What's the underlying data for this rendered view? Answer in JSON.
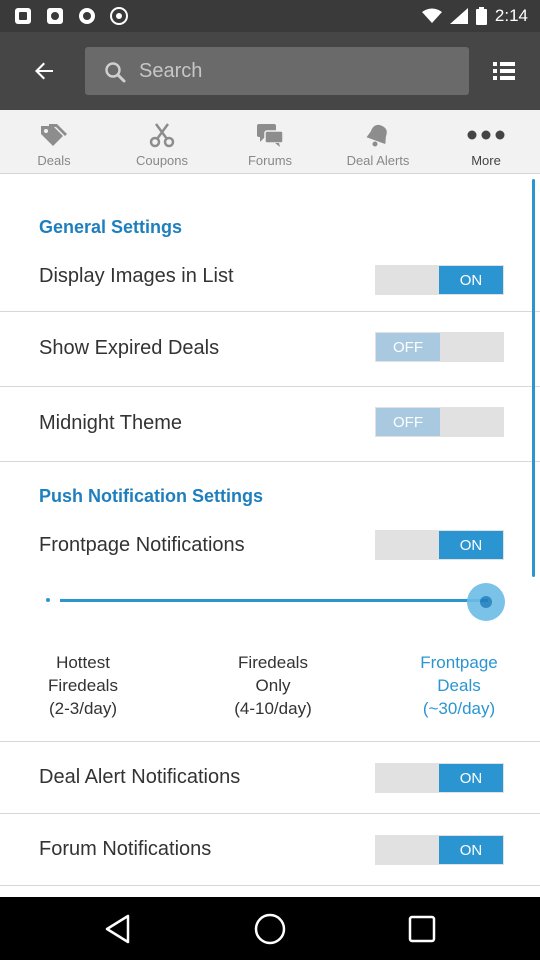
{
  "status_bar": {
    "time": "2:14"
  },
  "app_bar": {
    "search_placeholder": "Search"
  },
  "tabs": [
    {
      "label": "Deals",
      "icon": "tag-icon"
    },
    {
      "label": "Coupons",
      "icon": "scissors-icon"
    },
    {
      "label": "Forums",
      "icon": "chat-icon"
    },
    {
      "label": "Deal Alerts",
      "icon": "bell-icon"
    },
    {
      "label": "More",
      "icon": "more-icon"
    }
  ],
  "general": {
    "header": "General Settings",
    "display_images": {
      "label": "Display Images in List",
      "value": "ON"
    },
    "show_expired": {
      "label": "Show Expired Deals",
      "value": "OFF"
    },
    "midnight_theme": {
      "label": "Midnight Theme",
      "value": "OFF"
    }
  },
  "push": {
    "header": "Push Notification Settings",
    "frontpage": {
      "label": "Frontpage Notifications",
      "value": "ON"
    },
    "slider_value": 1.0,
    "options": [
      {
        "line1": "Hottest",
        "line2": "Firedeals",
        "line3": "(2-3/day)"
      },
      {
        "line1": "Firedeals",
        "line2": "Only",
        "line3": "(4-10/day)"
      },
      {
        "line1": "Frontpage",
        "line2": "Deals",
        "line3": "(~30/day)"
      }
    ],
    "deal_alert": {
      "label": "Deal Alert Notifications",
      "value": "ON"
    },
    "forum": {
      "label": "Forum Notifications",
      "value": "ON"
    }
  },
  "colors": {
    "accent": "#2b95d2",
    "header_blue": "#1e7fbf",
    "app_bar": "#464646"
  }
}
